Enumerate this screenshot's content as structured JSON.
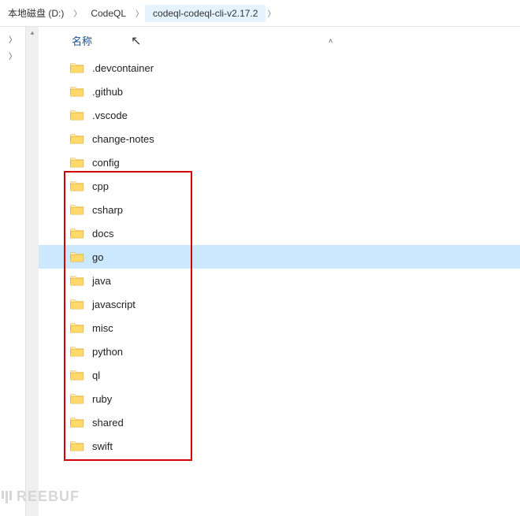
{
  "breadcrumb": {
    "items": [
      {
        "label": "本地磁盘 (D:)",
        "active": false
      },
      {
        "label": "CodeQL",
        "active": false
      },
      {
        "label": "codeql-codeql-cli-v2.17.2",
        "active": true
      }
    ]
  },
  "columns": {
    "name_header": "名称"
  },
  "folders": [
    {
      "name": ".devcontainer",
      "selected": false
    },
    {
      "name": ".github",
      "selected": false
    },
    {
      "name": ".vscode",
      "selected": false
    },
    {
      "name": "change-notes",
      "selected": false
    },
    {
      "name": "config",
      "selected": false
    },
    {
      "name": "cpp",
      "selected": false
    },
    {
      "name": "csharp",
      "selected": false
    },
    {
      "name": "docs",
      "selected": false
    },
    {
      "name": "go",
      "selected": true
    },
    {
      "name": "java",
      "selected": false
    },
    {
      "name": "javascript",
      "selected": false
    },
    {
      "name": "misc",
      "selected": false
    },
    {
      "name": "python",
      "selected": false
    },
    {
      "name": "ql",
      "selected": false
    },
    {
      "name": "ruby",
      "selected": false
    },
    {
      "name": "shared",
      "selected": false
    },
    {
      "name": "swift",
      "selected": false
    }
  ],
  "watermark": {
    "text": "REEBUF"
  },
  "highlight": {
    "start_index": 5,
    "end_index": 16
  }
}
